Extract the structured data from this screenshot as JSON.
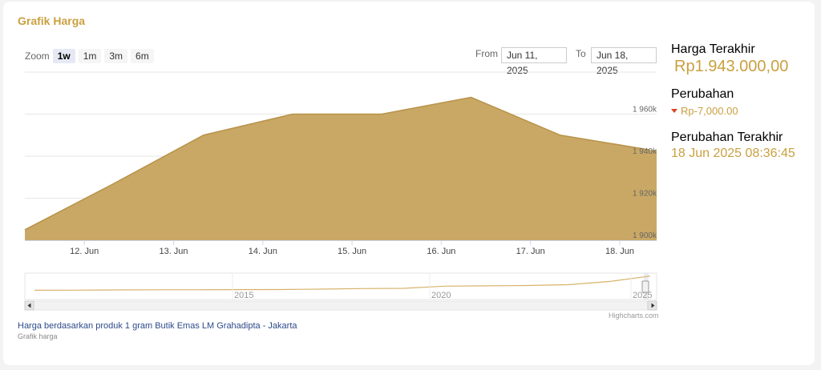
{
  "title": "Grafik Harga",
  "zoom": {
    "label": "Zoom",
    "buttons": [
      "1w",
      "1m",
      "3m",
      "6m"
    ],
    "active": "1w"
  },
  "range": {
    "from_label": "From",
    "from_value": "Jun 11, 2025",
    "to_label": "To",
    "to_value": "Jun 18, 2025"
  },
  "side": {
    "last_price_label": "Harga Terakhir",
    "last_price": "Rp1.943.000,00",
    "change_label": "Perubahan",
    "change": "Rp-7,000.00",
    "last_change_label": "Perubahan Terakhir",
    "last_change": "18 Jun 2025 08:36:45"
  },
  "credit": "Highcharts.com",
  "source": "Harga berdasarkan produk 1 gram Butik Emas LM Grahadipta - Jakarta",
  "subtitle": "Grafik harga",
  "colors": {
    "accent": "#c9a040",
    "area_fill": "#c9a865",
    "area_line": "#b8934a",
    "label_blue": "#2d4a8a",
    "down": "#d9431e"
  },
  "chart_data": {
    "type": "area",
    "x": [
      "2025-06-11 08:00",
      "2025-06-12 08:00",
      "2025-06-13 08:00",
      "2025-06-14 08:00",
      "2025-06-15 08:00",
      "2025-06-16 08:00",
      "2025-06-17 08:00",
      "2025-06-18 08:00"
    ],
    "values": [
      1905000,
      1927000,
      1950000,
      1960000,
      1960000,
      1968000,
      1950000,
      1943000
    ],
    "x_ticks": [
      "12. Jun",
      "13. Jun",
      "14. Jun",
      "15. Jun",
      "16. Jun",
      "17. Jun",
      "18. Jun"
    ],
    "y_ticks": [
      "1 900k",
      "1 920k",
      "1 940k",
      "1 960k"
    ],
    "ylim": [
      1900000,
      1980000
    ],
    "grid": true,
    "navigator": {
      "labels": [
        "2015",
        "2020",
        "2025"
      ],
      "values": [
        530000,
        540000,
        560000,
        580000,
        575000,
        590000,
        600000,
        640000,
        700000,
        720000,
        940000,
        970000,
        1000000,
        1080000,
        1400000,
        1943000
      ]
    }
  }
}
